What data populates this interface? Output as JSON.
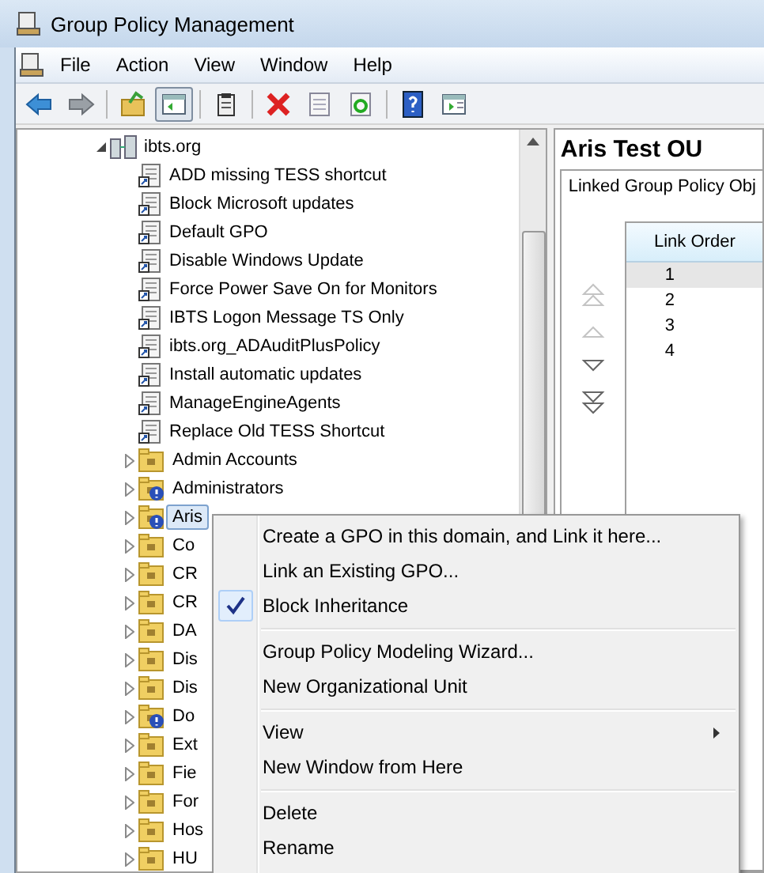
{
  "window": {
    "title": "Group Policy Management"
  },
  "menu_bar": [
    "File",
    "Action",
    "View",
    "Window",
    "Help"
  ],
  "toolbar": [
    {
      "pressed": false
    },
    {
      "pressed": false
    },
    {
      "pressed": false
    },
    {
      "pressed": true
    },
    {
      "pressed": false
    },
    {
      "pressed": false
    },
    {
      "pressed": false
    },
    {
      "pressed": false
    },
    {
      "pressed": false
    },
    {
      "pressed": false
    }
  ],
  "tree": {
    "label": "ibts.org",
    "expanded": true,
    "children": [
      {
        "kind": "gpo-link",
        "label": "ADD missing TESS shortcut",
        "selected": false
      },
      {
        "kind": "gpo-link",
        "label": "Block Microsoft updates",
        "selected": false
      },
      {
        "kind": "gpo-link",
        "label": "Default GPO",
        "selected": false
      },
      {
        "kind": "gpo-link",
        "label": "Disable Windows Update",
        "selected": false
      },
      {
        "kind": "gpo-link",
        "label": "Force Power Save On for Monitors",
        "selected": false
      },
      {
        "kind": "gpo-link",
        "label": "IBTS Logon Message TS Only",
        "selected": false
      },
      {
        "kind": "gpo-link",
        "label": "ibts.org_ADAuditPlusPolicy",
        "selected": false
      },
      {
        "kind": "gpo-link",
        "label": "Install automatic updates",
        "selected": false
      },
      {
        "kind": "gpo-link",
        "label": "ManageEngineAgents",
        "selected": false
      },
      {
        "kind": "gpo-link",
        "label": "Replace Old TESS Shortcut",
        "selected": false
      },
      {
        "kind": "ou",
        "label": "Admin Accounts",
        "expanded": false,
        "warning": false,
        "selected": false
      },
      {
        "kind": "ou",
        "label": "Administrators",
        "expanded": false,
        "warning": true,
        "selected": false
      },
      {
        "kind": "ou",
        "label": "Aris",
        "expanded": false,
        "warning": true,
        "selected": true
      },
      {
        "kind": "ou",
        "label": "Co",
        "expanded": false,
        "warning": false,
        "selected": false
      },
      {
        "kind": "ou",
        "label": "CR",
        "expanded": false,
        "warning": false,
        "selected": false
      },
      {
        "kind": "ou",
        "label": "CR",
        "expanded": false,
        "warning": false,
        "selected": false
      },
      {
        "kind": "ou",
        "label": "DA",
        "expanded": false,
        "warning": false,
        "selected": false
      },
      {
        "kind": "ou",
        "label": "Dis",
        "expanded": false,
        "warning": false,
        "selected": false
      },
      {
        "kind": "ou",
        "label": "Dis",
        "expanded": false,
        "warning": false,
        "selected": false
      },
      {
        "kind": "ou",
        "label": "Do",
        "expanded": false,
        "warning": true,
        "selected": false
      },
      {
        "kind": "ou",
        "label": "Ext",
        "expanded": false,
        "warning": false,
        "selected": false
      },
      {
        "kind": "ou",
        "label": "Fie",
        "expanded": false,
        "warning": false,
        "selected": false
      },
      {
        "kind": "ou",
        "label": "For",
        "expanded": false,
        "warning": false,
        "selected": false
      },
      {
        "kind": "ou",
        "label": "Hos",
        "expanded": false,
        "warning": false,
        "selected": false
      },
      {
        "kind": "ou",
        "label": "HU",
        "expanded": false,
        "warning": false,
        "selected": false
      }
    ]
  },
  "details": {
    "title": "Aris Test OU",
    "tab": "Linked Group Policy Obj",
    "order_buttons": [
      {
        "disabled": true
      },
      {
        "disabled": true
      },
      {
        "disabled": false
      },
      {
        "disabled": false
      }
    ],
    "table": {
      "columns": [
        "Link Order"
      ],
      "rows": [
        {
          "cells": [
            "1"
          ],
          "selected": true
        },
        {
          "cells": [
            "2"
          ],
          "selected": false
        },
        {
          "cells": [
            "3"
          ],
          "selected": false
        },
        {
          "cells": [
            "4"
          ],
          "selected": false
        }
      ]
    }
  },
  "context_menu": [
    {
      "kind": "item",
      "label": "Create a GPO in this domain, and Link it here...",
      "checked": false,
      "submenu": false
    },
    {
      "kind": "item",
      "label": "Link an Existing GPO...",
      "checked": false,
      "submenu": false
    },
    {
      "kind": "item",
      "label": "Block Inheritance",
      "checked": true,
      "submenu": false
    },
    {
      "kind": "separator"
    },
    {
      "kind": "item",
      "label": "Group Policy Modeling Wizard...",
      "checked": false,
      "submenu": false
    },
    {
      "kind": "item",
      "label": "New Organizational Unit",
      "checked": false,
      "submenu": false
    },
    {
      "kind": "separator"
    },
    {
      "kind": "item",
      "label": "View",
      "checked": false,
      "submenu": true
    },
    {
      "kind": "item",
      "label": "New Window from Here",
      "checked": false,
      "submenu": false
    },
    {
      "kind": "separator"
    },
    {
      "kind": "item",
      "label": "Delete",
      "checked": false,
      "submenu": false
    },
    {
      "kind": "item",
      "label": "Rename",
      "checked": false,
      "submenu": false
    }
  ]
}
